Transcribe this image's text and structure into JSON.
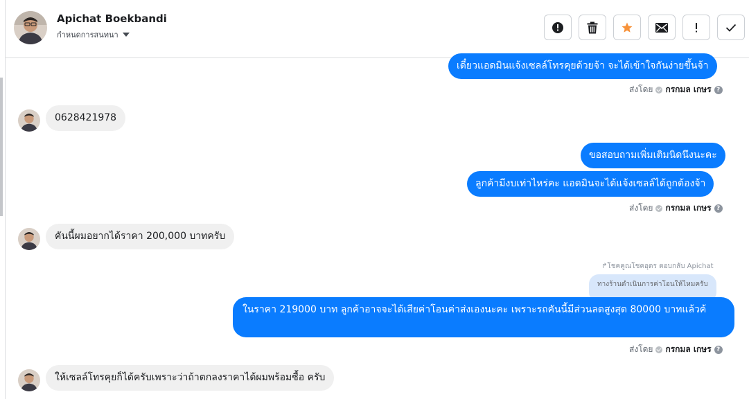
{
  "header": {
    "name": "Apichat Boekbandi",
    "subtitle": "กำหนดการสนทนา",
    "actions": [
      {
        "icon": "alert-circle-icon"
      },
      {
        "icon": "trash-icon"
      },
      {
        "icon": "star-icon"
      },
      {
        "icon": "envelope-icon"
      },
      {
        "icon": "exclamation-icon"
      },
      {
        "icon": "checkmark-icon"
      }
    ]
  },
  "colors": {
    "outgoing_bubble": "#0a7cff",
    "incoming_bubble": "#f0f0f0",
    "star": "#f7923a",
    "reply_quote_bg": "#d8e7fb"
  },
  "messages": {
    "m1": {
      "direction": "out",
      "text": "เดี๋ยวแอดมินแจ้งเซลล์โทรคุยด้วยจ้า จะได้เข้าใจกันง่ายขึ้นจ้า"
    },
    "m1_sent": {
      "prefix": "ส่งโดย",
      "by": "กรกมล เกษร",
      "help": "?"
    },
    "m2": {
      "direction": "in",
      "text": "0628421978"
    },
    "m3": {
      "direction": "out",
      "text": "ขอสอบถามเพิ่มเติมนิดนึงนะคะ"
    },
    "m4": {
      "direction": "out",
      "text": "ลูกค้ามีงบเท่าไหร่คะ แอดมินจะได้แจ้งเซลล์ได้ถูกต้องจ้า"
    },
    "m4_sent": {
      "prefix": "ส่งโดย",
      "by": "กรกมล เกษร",
      "help": "?"
    },
    "m5": {
      "direction": "in",
      "text": "คันนี้ผมอยากได้ราคา 200,000 บาทครับ"
    },
    "reply_label": "โชคคูณโชคอุดร ตอบกลับ Apichat",
    "reply_quote": "ทางร้านดำเนินการค่าโอนให้ไหมครับ",
    "m6": {
      "direction": "out",
      "text": "ในราคา 219000 บาท ลูกค้าอาจจะได้เสียค่าโอนค่าส่งเองนะคะ เพราะรถคันนี้มีส่วนลดสูงสุด 80000 บาทแล้วค้"
    },
    "m6_sent": {
      "prefix": "ส่งโดย",
      "by": "กรกมล เกษร",
      "help": "?"
    },
    "m7": {
      "direction": "in",
      "text": "ให้เซลล์โทรคุยก็ได้ครับเพราะว่าถ้าตกลงราคาได้ผมพร้อมซื้อ ครับ"
    }
  }
}
